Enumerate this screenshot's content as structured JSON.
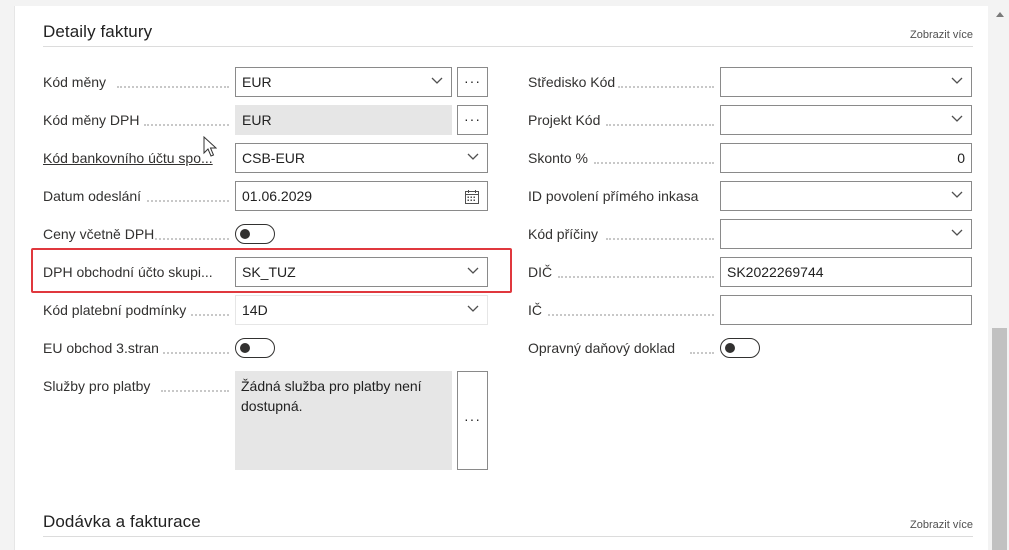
{
  "section_details": {
    "title": "Detaily faktury",
    "show_more": "Zobrazit více"
  },
  "section_delivery": {
    "title": "Dodávka a fakturace",
    "show_more": "Zobrazit více"
  },
  "left_fields": {
    "currency_code": {
      "label": "Kód měny",
      "value": "EUR"
    },
    "vat_currency_code": {
      "label": "Kód měny DPH",
      "value": "EUR"
    },
    "bank_account_code": {
      "label": "Kód bankovního účtu spo...",
      "value": "CSB-EUR"
    },
    "posting_date": {
      "label": "Datum odeslání",
      "value": "01.06.2029"
    },
    "prices_incl_vat": {
      "label": "Ceny včetně DPH",
      "checked": false
    },
    "vat_bus_posting_group": {
      "label": "DPH obchodní účto skupi...",
      "value": "SK_TUZ"
    },
    "payment_terms_code": {
      "label": "Kód platební podmínky",
      "value": "14D"
    },
    "eu_3rd_party_trade": {
      "label": "EU obchod 3.stran",
      "checked": false
    },
    "payment_services": {
      "label": "Služby pro platby",
      "value": "Žádná služba pro platby není dostupná."
    }
  },
  "right_fields": {
    "department_code": {
      "label": "Středisko Kód",
      "value": ""
    },
    "project_code": {
      "label": "Projekt Kód",
      "value": ""
    },
    "discount_pct": {
      "label": "Skonto %",
      "value": "0"
    },
    "direct_debit_mandate": {
      "label": "ID povolení přímého inkasa",
      "value": ""
    },
    "reason_code": {
      "label": "Kód příčiny",
      "value": ""
    },
    "vat_reg_no": {
      "label": "DIČ",
      "value": "SK2022269744"
    },
    "reg_no": {
      "label": "IČ",
      "value": ""
    },
    "corrective_tax_doc": {
      "label": "Opravný daňový doklad",
      "checked": false
    }
  },
  "ellipsis_glyph": "···",
  "colors": {
    "highlight": "#e0383e",
    "readonly_bg": "#e6e6e6",
    "border": "#8a8a8a"
  }
}
